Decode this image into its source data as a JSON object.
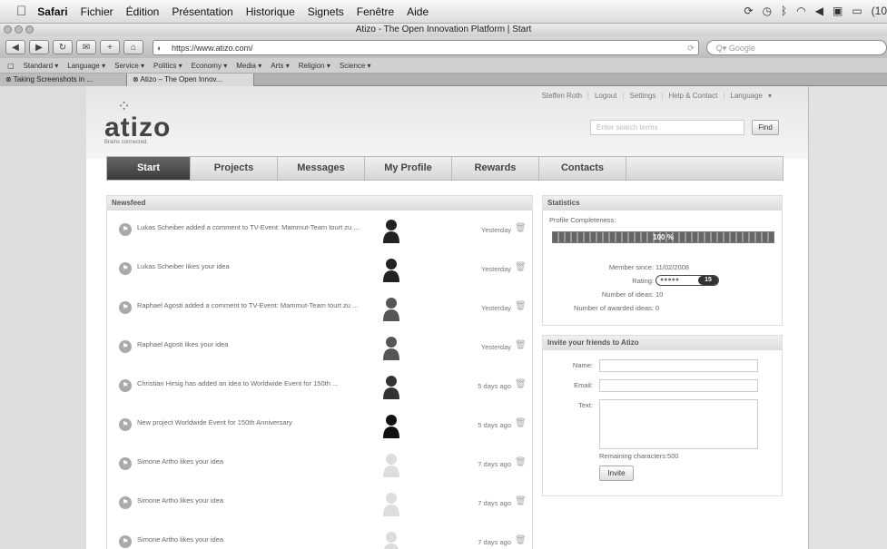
{
  "menubar": {
    "app": "Safari",
    "items": [
      "Fichier",
      "Édition",
      "Présentation",
      "Historique",
      "Signets",
      "Fenêtre",
      "Aide"
    ],
    "clock": "(10"
  },
  "window": {
    "title": "Atizo - The Open Innovation Platform | Start"
  },
  "toolbar": {
    "url": "https://www.atizo.com/",
    "search_placeholder": "Q▾ Google"
  },
  "bookmarks": [
    "Standard ▾",
    "Language ▾",
    "Service ▾",
    "Politics ▾",
    "Economy ▾",
    "Media ▾",
    "Arts ▾",
    "Religion ▾",
    "Science ▾"
  ],
  "tabs": [
    {
      "label": "Taking Screenshots in ..."
    },
    {
      "label": "Atizo – The Open Innov..."
    }
  ],
  "site": {
    "logo": "atizo",
    "tagline": "Brains connected.",
    "user_nav": [
      "Steffen Roth",
      "Logout",
      "Settings",
      "Help & Contact",
      "Language"
    ],
    "search_placeholder": "Enter search terms",
    "find_label": "Find",
    "nav": [
      "Start",
      "Projects",
      "Messages",
      "My Profile",
      "Rewards",
      "Contacts"
    ],
    "newsfeed_title": "Newsfeed",
    "feed": [
      {
        "text": "Lukas Scheiber added a comment to TV-Event: Mammut-Team tourt zu ...",
        "time": "Yesterday",
        "avatar": "person-dark"
      },
      {
        "text": "Lukas Scheiber likes your idea",
        "time": "Yesterday",
        "avatar": "person-dark"
      },
      {
        "text": "Raphael Agosti added a comment to TV-Event: Mammut-Team tourt zu ...",
        "time": "Yesterday",
        "avatar": "person-light"
      },
      {
        "text": "Raphael Agosti likes your idea",
        "time": "Yesterday",
        "avatar": "person-light"
      },
      {
        "text": "Christian Hirsig has added an idea to Worldwide Event for 150th ...",
        "time": "5 days ago",
        "avatar": "person-standing"
      },
      {
        "text": "New project Worldwide Event for 150th Anniversary",
        "time": "5 days ago",
        "avatar": "project-logo"
      },
      {
        "text": "Simone Artho likes your idea",
        "time": "7 days ago",
        "avatar": "person-placeholder"
      },
      {
        "text": "Simone Artho likes your idea",
        "time": "7 days ago",
        "avatar": "person-placeholder"
      },
      {
        "text": "Simone Artho likes your idea",
        "time": "7 days ago",
        "avatar": "person-placeholder"
      }
    ],
    "stats": {
      "title": "Statistics",
      "completeness_label": "Profile Completeness:",
      "completeness_text": "100 %",
      "completeness": 1.0,
      "member_since_label": "Member since:",
      "member_since": "11/02/2008",
      "rating_label": "Rating:",
      "rating_dots": "●●●●●",
      "rating": "15",
      "ideas_label": "Number of ideas:",
      "ideas": "10",
      "awarded_label": "Number of awarded ideas:",
      "awarded": "0"
    },
    "invite": {
      "title": "Invite your friends to Atizo",
      "name_label": "Name:",
      "email_label": "Email:",
      "text_label": "Text:",
      "remaining": "Remaining characters:500",
      "button": "Invite"
    }
  }
}
